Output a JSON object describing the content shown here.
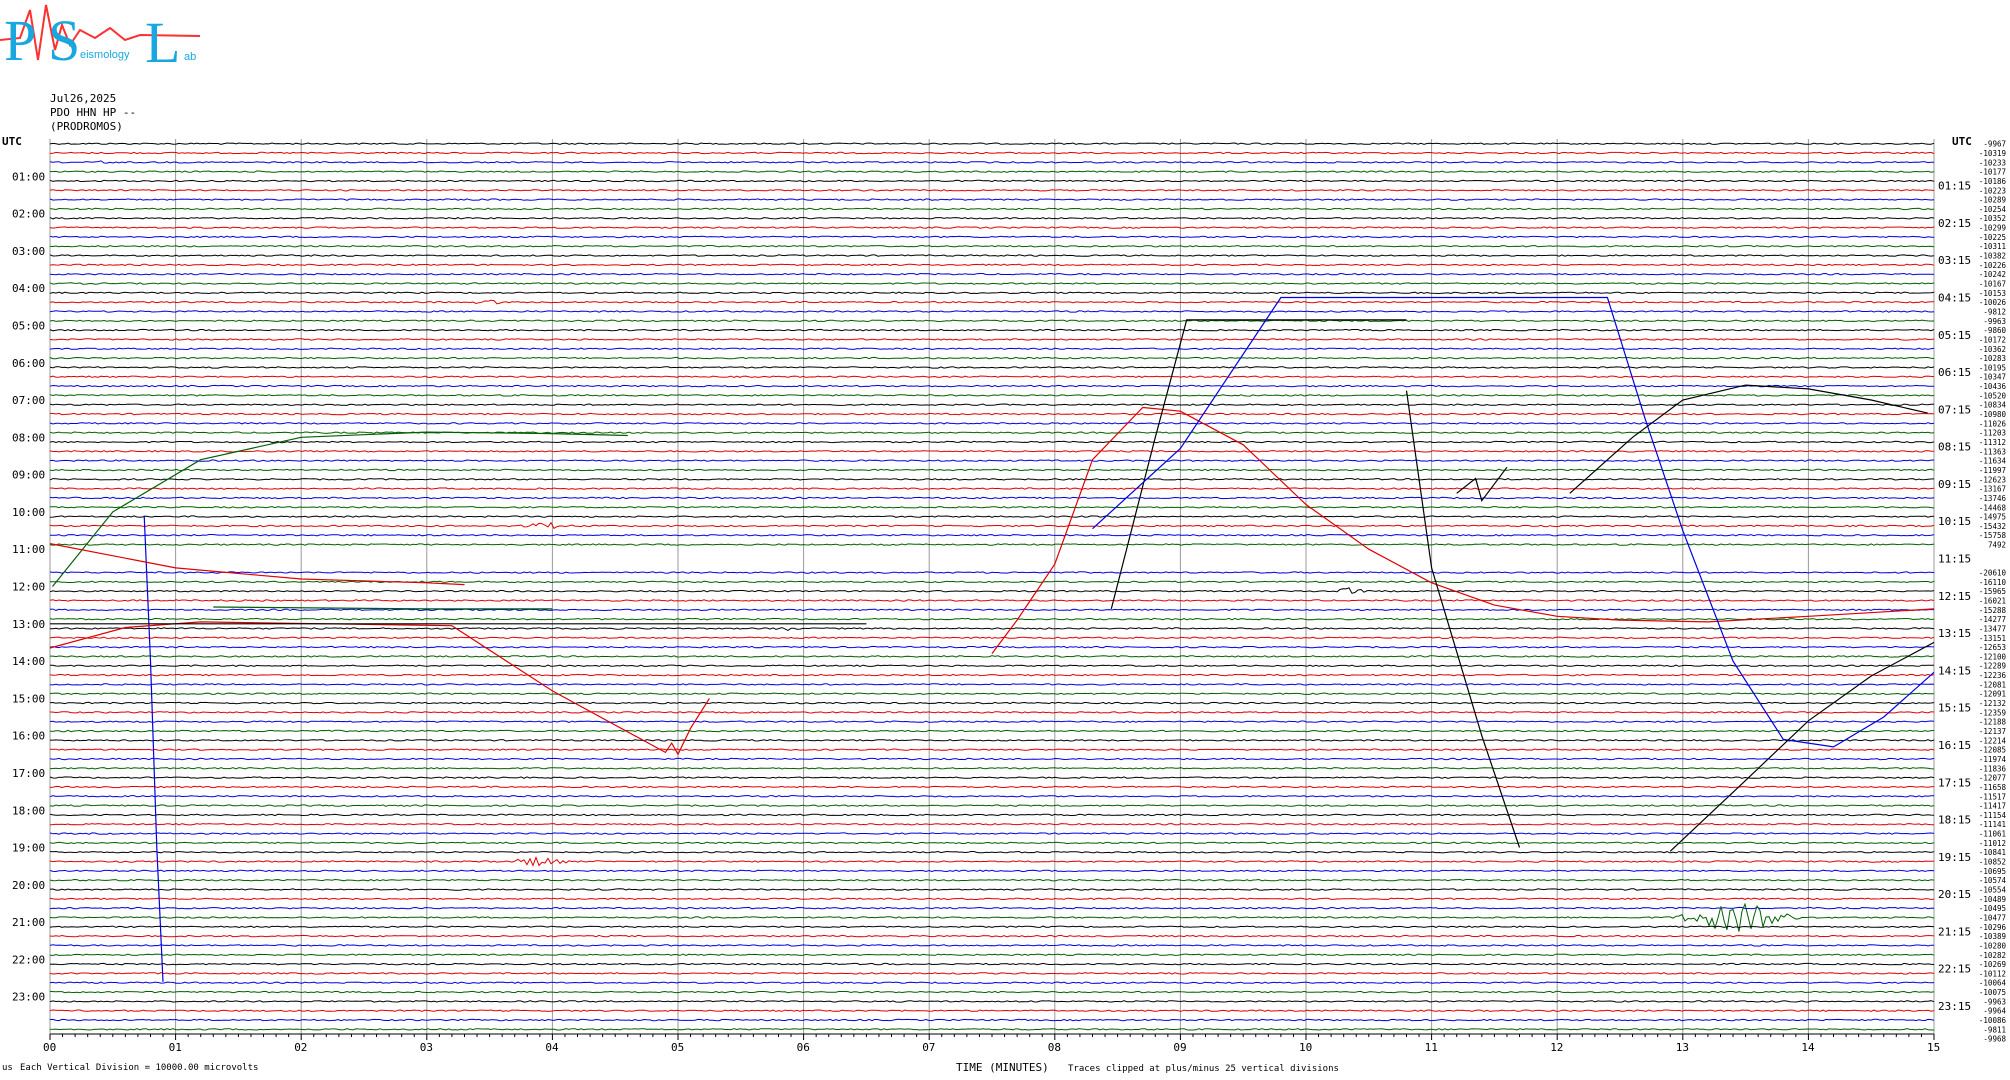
{
  "logo": {
    "letters": [
      "P",
      "S",
      "L"
    ],
    "subtitle": "eismology",
    "suffix": "ab",
    "color_main": "#19a7e0",
    "color_accent": "#ff3030"
  },
  "header": {
    "date": "Jul26,2025",
    "channel": "PDO HHN HP --",
    "station": "(PRODROMOS)"
  },
  "footer": {
    "legend": "Each Vertical Division = 10000.00 microvolts",
    "xlabel": "TIME (MINUTES)",
    "clip_note": "Traces clipped at plus/minus 25 vertical divisions",
    "mark": "us"
  },
  "chart_data": {
    "type": "line",
    "title": "",
    "xlabel": "TIME (MINUTES)",
    "ylabel": "",
    "xlim": [
      0,
      15
    ],
    "x_ticks": [
      "00",
      "01",
      "02",
      "03",
      "04",
      "05",
      "06",
      "07",
      "08",
      "09",
      "10",
      "11",
      "12",
      "13",
      "14",
      "15"
    ],
    "left_axis_title": "UTC",
    "right_axis_title": "UTC",
    "left_labels": [
      "01:00",
      "02:00",
      "03:00",
      "04:00",
      "05:00",
      "06:00",
      "07:00",
      "08:00",
      "09:00",
      "10:00",
      "11:00",
      "12:00",
      "13:00",
      "14:00",
      "15:00",
      "16:00",
      "17:00",
      "18:00",
      "19:00",
      "20:00",
      "21:00",
      "22:00",
      "23:00"
    ],
    "right_labels": [
      "01:15",
      "02:15",
      "03:15",
      "04:15",
      "05:15",
      "06:15",
      "07:15",
      "08:15",
      "09:15",
      "10:15",
      "11:15",
      "12:15",
      "13:15",
      "14:15",
      "15:15",
      "16:15",
      "17:15",
      "18:15",
      "19:15",
      "20:15",
      "21:15",
      "22:15",
      "23:15"
    ],
    "trace_colors": [
      "#000000",
      "#e00000",
      "#0000e0",
      "#006000"
    ],
    "trace_count": 96,
    "trace_offsets": [
      "-9967",
      "-10319",
      "-10233",
      "-10177",
      "-10186",
      "-10223",
      "-10289",
      "-10254",
      "-10352",
      "-10299",
      "-10225",
      "-10311",
      "-10382",
      "-10226",
      "-10242",
      "-10167",
      "-10153",
      "-10026",
      "-9812",
      "-9963",
      "-9860",
      "-10172",
      "-10362",
      "-10283",
      "-10195",
      "-10347",
      "-10436",
      "-10520",
      "-10834",
      "-10980",
      "-11026",
      "-11203",
      "-11312",
      "-11363",
      "-11634",
      "-11997",
      "-12623",
      "-13167",
      "-13746",
      "-14468",
      "-14975",
      "-15432",
      "-15758",
      "7492",
      "",
      "",
      "-20610",
      "-16110",
      "-15965",
      "-16021",
      "-15288",
      "-14277",
      "-13477",
      "-13151",
      "-12653",
      "-12100",
      "-12289",
      "-12236",
      "-12081",
      "-12091",
      "-12132",
      "-12359",
      "-12188",
      "-12137",
      "-12214",
      "-12085",
      "-11974",
      "-11836",
      "-12077",
      "-11658",
      "-11517",
      "-11417",
      "-11154",
      "-11141",
      "-11061",
      "-11012",
      "-10841",
      "-10852",
      "-10695",
      "-10574",
      "-10554",
      "-10489",
      "-10495",
      "-10477",
      "-10296",
      "-10389",
      "-10280",
      "-10282",
      "-10269",
      "-10112",
      "-10064",
      "-10075",
      "-9963",
      "-9964",
      "-10086",
      "-9811",
      "-9968"
    ],
    "blank_traces": [
      44,
      45
    ],
    "events": [
      {
        "trace": 5,
        "color": "black",
        "x_min": [
          0.35,
          0.5
        ],
        "amp": 3
      },
      {
        "trace": 35,
        "color": "green",
        "x_min": [
          3.3,
          3.8
        ],
        "amp": 2
      },
      {
        "trace": 82,
        "color": "black",
        "x_min": [
          3.6,
          4.3
        ],
        "amp": 3
      },
      {
        "trace": 88,
        "color": "blue",
        "x_min": [
          11.1,
          11.6
        ],
        "amp": 3
      },
      {
        "trace": 96,
        "color": "red",
        "x_min": [
          10.2,
          10.5
        ],
        "amp": 4
      },
      {
        "trace": 104,
        "color": "blue",
        "x_min": [
          5.75,
          5.95
        ],
        "amp": 3
      },
      {
        "trace": 155,
        "color": "black",
        "x_min": [
          3.6,
          4.2
        ],
        "amp": 5
      },
      {
        "trace": 166,
        "color": "blue",
        "x_min": [
          12.9,
          14.0
        ],
        "amp": 16
      },
      {
        "trace": 196,
        "color": "green",
        "x_min": [
          4.9,
          5.3
        ],
        "amp": 3
      },
      {
        "trace": 198,
        "color": "red",
        "x_min": [
          12.8,
          13.0
        ],
        "amp": 3
      }
    ],
    "long_period_curves": [
      {
        "color": "#006000",
        "points": [
          [
            0.02,
            12.0
          ],
          [
            0.5,
            10.0
          ],
          [
            1.2,
            8.6
          ],
          [
            2.0,
            8.0
          ],
          [
            3.0,
            7.86
          ],
          [
            4.0,
            7.9
          ],
          [
            4.6,
            7.95
          ]
        ]
      },
      {
        "color": "#0000e0",
        "points": [
          [
            0.75,
            10.1
          ],
          [
            0.8,
            14.0
          ],
          [
            0.85,
            19.0
          ],
          [
            0.9,
            22.6
          ]
        ]
      },
      {
        "color": "#e00000",
        "points": [
          [
            0.0,
            10.85
          ],
          [
            1.0,
            11.5
          ],
          [
            2.0,
            11.8
          ],
          [
            3.0,
            11.9
          ],
          [
            3.3,
            11.95
          ]
        ]
      },
      {
        "color": "#e00000",
        "points": [
          [
            0.0,
            13.65
          ],
          [
            0.6,
            13.1
          ],
          [
            1.2,
            12.95
          ],
          [
            2.2,
            13.0
          ],
          [
            3.2,
            13.05
          ],
          [
            4.0,
            14.8
          ],
          [
            4.9,
            16.45
          ],
          [
            4.95,
            16.2
          ],
          [
            5.0,
            16.5
          ],
          [
            5.1,
            15.8
          ],
          [
            5.25,
            15.0
          ]
        ]
      },
      {
        "color": "#000000",
        "points": [
          [
            0.0,
            13.0
          ],
          [
            6.5,
            13.0
          ]
        ]
      },
      {
        "color": "#006000",
        "points": [
          [
            1.3,
            12.55
          ],
          [
            3.0,
            12.6
          ],
          [
            4.0,
            12.6
          ]
        ]
      },
      {
        "color": "#e00000",
        "points": [
          [
            7.5,
            13.8
          ],
          [
            7.7,
            12.9
          ],
          [
            8.0,
            11.4
          ],
          [
            8.3,
            8.6
          ],
          [
            8.7,
            7.2
          ],
          [
            9.0,
            7.3
          ],
          [
            9.5,
            8.2
          ],
          [
            10.0,
            9.8
          ],
          [
            10.5,
            11.0
          ],
          [
            11.0,
            11.9
          ],
          [
            11.5,
            12.5
          ],
          [
            12.0,
            12.8
          ],
          [
            12.5,
            12.9
          ],
          [
            13.2,
            12.95
          ],
          [
            14.0,
            12.8
          ],
          [
            15.0,
            12.6
          ]
        ]
      },
      {
        "color": "#000000",
        "points": [
          [
            8.45,
            12.6
          ],
          [
            8.8,
            8.0
          ],
          [
            9.05,
            4.85
          ],
          [
            10.0,
            4.85
          ],
          [
            10.8,
            4.85
          ]
        ]
      },
      {
        "color": "#0000e0",
        "points": [
          [
            8.3,
            10.45
          ],
          [
            9.0,
            8.3
          ],
          [
            9.8,
            4.25
          ],
          [
            11.0,
            4.25
          ],
          [
            12.4,
            4.25
          ],
          [
            12.7,
            7.5
          ],
          [
            13.0,
            10.5
          ],
          [
            13.4,
            14.0
          ],
          [
            13.8,
            16.1
          ],
          [
            14.2,
            16.3
          ],
          [
            14.6,
            15.5
          ],
          [
            15.0,
            14.3
          ]
        ]
      },
      {
        "color": "#000000",
        "points": [
          [
            10.8,
            6.75
          ],
          [
            11.0,
            11.5
          ],
          [
            11.4,
            16.0
          ],
          [
            11.7,
            19.0
          ]
        ]
      },
      {
        "color": "#000000",
        "points": [
          [
            12.1,
            9.5
          ],
          [
            12.6,
            8.0
          ],
          [
            13.0,
            7.0
          ],
          [
            13.5,
            6.6
          ],
          [
            14.0,
            6.7
          ],
          [
            14.5,
            7.0
          ],
          [
            14.95,
            7.35
          ]
        ]
      },
      {
        "color": "#000000",
        "points": [
          [
            12.9,
            19.1
          ],
          [
            13.5,
            17.2
          ],
          [
            14.0,
            15.6
          ],
          [
            14.5,
            14.4
          ],
          [
            15.0,
            13.5
          ]
        ]
      },
      {
        "color": "#000000",
        "points": [
          [
            11.2,
            9.5
          ],
          [
            11.35,
            9.1
          ],
          [
            11.4,
            9.7
          ],
          [
            11.6,
            8.8
          ]
        ]
      }
    ]
  }
}
